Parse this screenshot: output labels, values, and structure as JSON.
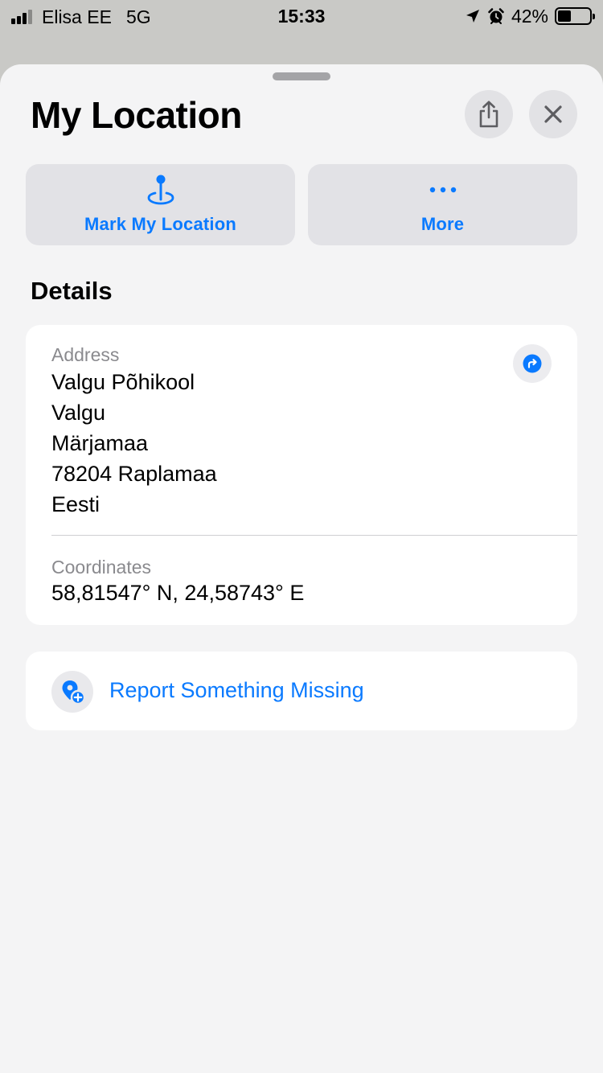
{
  "status_bar": {
    "carrier": "Elisa EE",
    "network": "5G",
    "time": "15:33",
    "battery_percent": "42%",
    "battery_level": 0.42,
    "icons": [
      "signal-icon",
      "location-arrow-icon",
      "alarm-icon",
      "battery-icon"
    ]
  },
  "sheet": {
    "title": "My Location",
    "share_icon": "share-icon",
    "close_icon": "close-icon"
  },
  "actions": {
    "mark_location": {
      "label": "Mark My Location",
      "icon": "pin-icon"
    },
    "more": {
      "label": "More",
      "icon": "ellipsis-icon"
    }
  },
  "details": {
    "section_title": "Details",
    "address_label": "Address",
    "address_lines": [
      "Valgu Põhikool",
      "Valgu",
      "Märjamaa",
      "78204 Raplamaa",
      "Eesti"
    ],
    "directions_icon": "directions-icon",
    "coordinates_label": "Coordinates",
    "coordinates_value": "58,81547° N, 24,58743° E"
  },
  "report": {
    "label": "Report Something Missing",
    "icon": "add-place-icon"
  },
  "colors": {
    "accent": "#0a7aff",
    "sheet_background": "#f4f4f5",
    "card_background": "#ffffff",
    "secondary_text": "#8a8a8e"
  }
}
